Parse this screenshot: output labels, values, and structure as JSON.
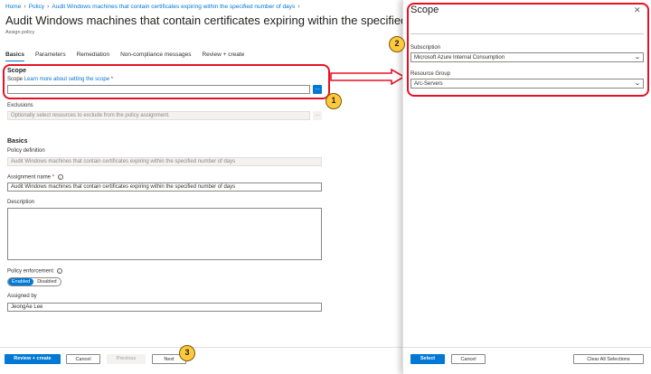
{
  "breadcrumb": [
    "Home",
    "Policy",
    "Audit Windows machines that contain certificates expiring within the specified number of days"
  ],
  "title": "Audit Windows machines that contain certificates expiring within the specified numbe",
  "subtitle": "Assign policy",
  "tabs": [
    "Basics",
    "Parameters",
    "Remediation",
    "Non-compliance messages",
    "Review + create"
  ],
  "scope": {
    "heading": "Scope",
    "label": "Scope",
    "link": "Learn more about setting the scope",
    "required": "*",
    "value": "",
    "browse": "..."
  },
  "exclusions": {
    "label": "Exclusions",
    "placeholder": "Optionally select resources to exclude from the policy assignment.",
    "browse": "..."
  },
  "basics": {
    "heading": "Basics",
    "policy_definition_label": "Policy definition",
    "policy_definition_value": "Audit Windows machines that contain certificates expiring within the specified number of days",
    "assignment_name_label": "Assignment name",
    "assignment_name_required": "*",
    "assignment_name_value": "Audit Windows machines that contain certificates expiring within the specified number of days",
    "description_label": "Description",
    "description_value": "",
    "enforcement_label": "Policy enforcement",
    "enforcement_enabled": "Enabled",
    "enforcement_disabled": "Disabled",
    "assigned_by_label": "Assigned by",
    "assigned_by_value": "JeongAe Lee"
  },
  "footer": {
    "review_create": "Review + create",
    "cancel": "Cancel",
    "previous": "Previous",
    "next": "Next"
  },
  "panel": {
    "title": "Scope",
    "close": "✕",
    "subscription_label": "Subscription",
    "subscription_value": "Microsoft Azure Internal Consumption",
    "resource_group_label": "Resource Group",
    "resource_group_value": "Arc-Servers",
    "select": "Select",
    "cancel": "Cancel",
    "clear_all": "Clear All Selections"
  },
  "badges": [
    "1",
    "2",
    "3"
  ],
  "colors": {
    "accent": "#0078d4",
    "highlight": "#e81123",
    "badge": "#ffc83d"
  }
}
